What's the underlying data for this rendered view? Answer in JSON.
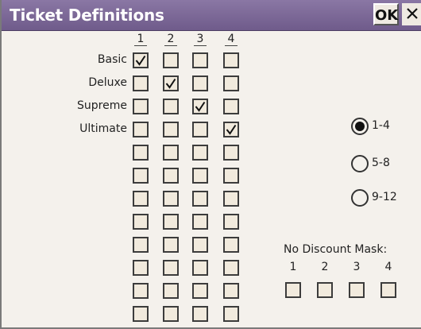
{
  "window": {
    "title": "Ticket Definitions",
    "ok_label": "OK"
  },
  "columns": [
    "1",
    "2",
    "3",
    "4"
  ],
  "rows": [
    {
      "label": "Basic",
      "checked": [
        true,
        false,
        false,
        false
      ]
    },
    {
      "label": "Deluxe",
      "checked": [
        false,
        true,
        false,
        false
      ]
    },
    {
      "label": "Supreme",
      "checked": [
        false,
        false,
        true,
        false
      ]
    },
    {
      "label": "Ultimate",
      "checked": [
        false,
        false,
        false,
        true
      ]
    },
    {
      "label": "",
      "checked": [
        false,
        false,
        false,
        false
      ]
    },
    {
      "label": "",
      "checked": [
        false,
        false,
        false,
        false
      ]
    },
    {
      "label": "",
      "checked": [
        false,
        false,
        false,
        false
      ]
    },
    {
      "label": "",
      "checked": [
        false,
        false,
        false,
        false
      ]
    },
    {
      "label": "",
      "checked": [
        false,
        false,
        false,
        false
      ]
    },
    {
      "label": "",
      "checked": [
        false,
        false,
        false,
        false
      ]
    },
    {
      "label": "",
      "checked": [
        false,
        false,
        false,
        false
      ]
    },
    {
      "label": "",
      "checked": [
        false,
        false,
        false,
        false
      ]
    }
  ],
  "range_options": [
    {
      "label": "1-4",
      "selected": true
    },
    {
      "label": "5-8",
      "selected": false
    },
    {
      "label": "9-12",
      "selected": false
    }
  ],
  "no_discount": {
    "title": "No Discount Mask:",
    "columns": [
      "1",
      "2",
      "3",
      "4"
    ],
    "checked": [
      false,
      false,
      false,
      false
    ]
  },
  "colors": {
    "titlebar": "#7a67a0",
    "checkbox_fill": "#f1eadd"
  },
  "icons": {
    "close": "close-icon",
    "check": "checkmark-icon"
  }
}
